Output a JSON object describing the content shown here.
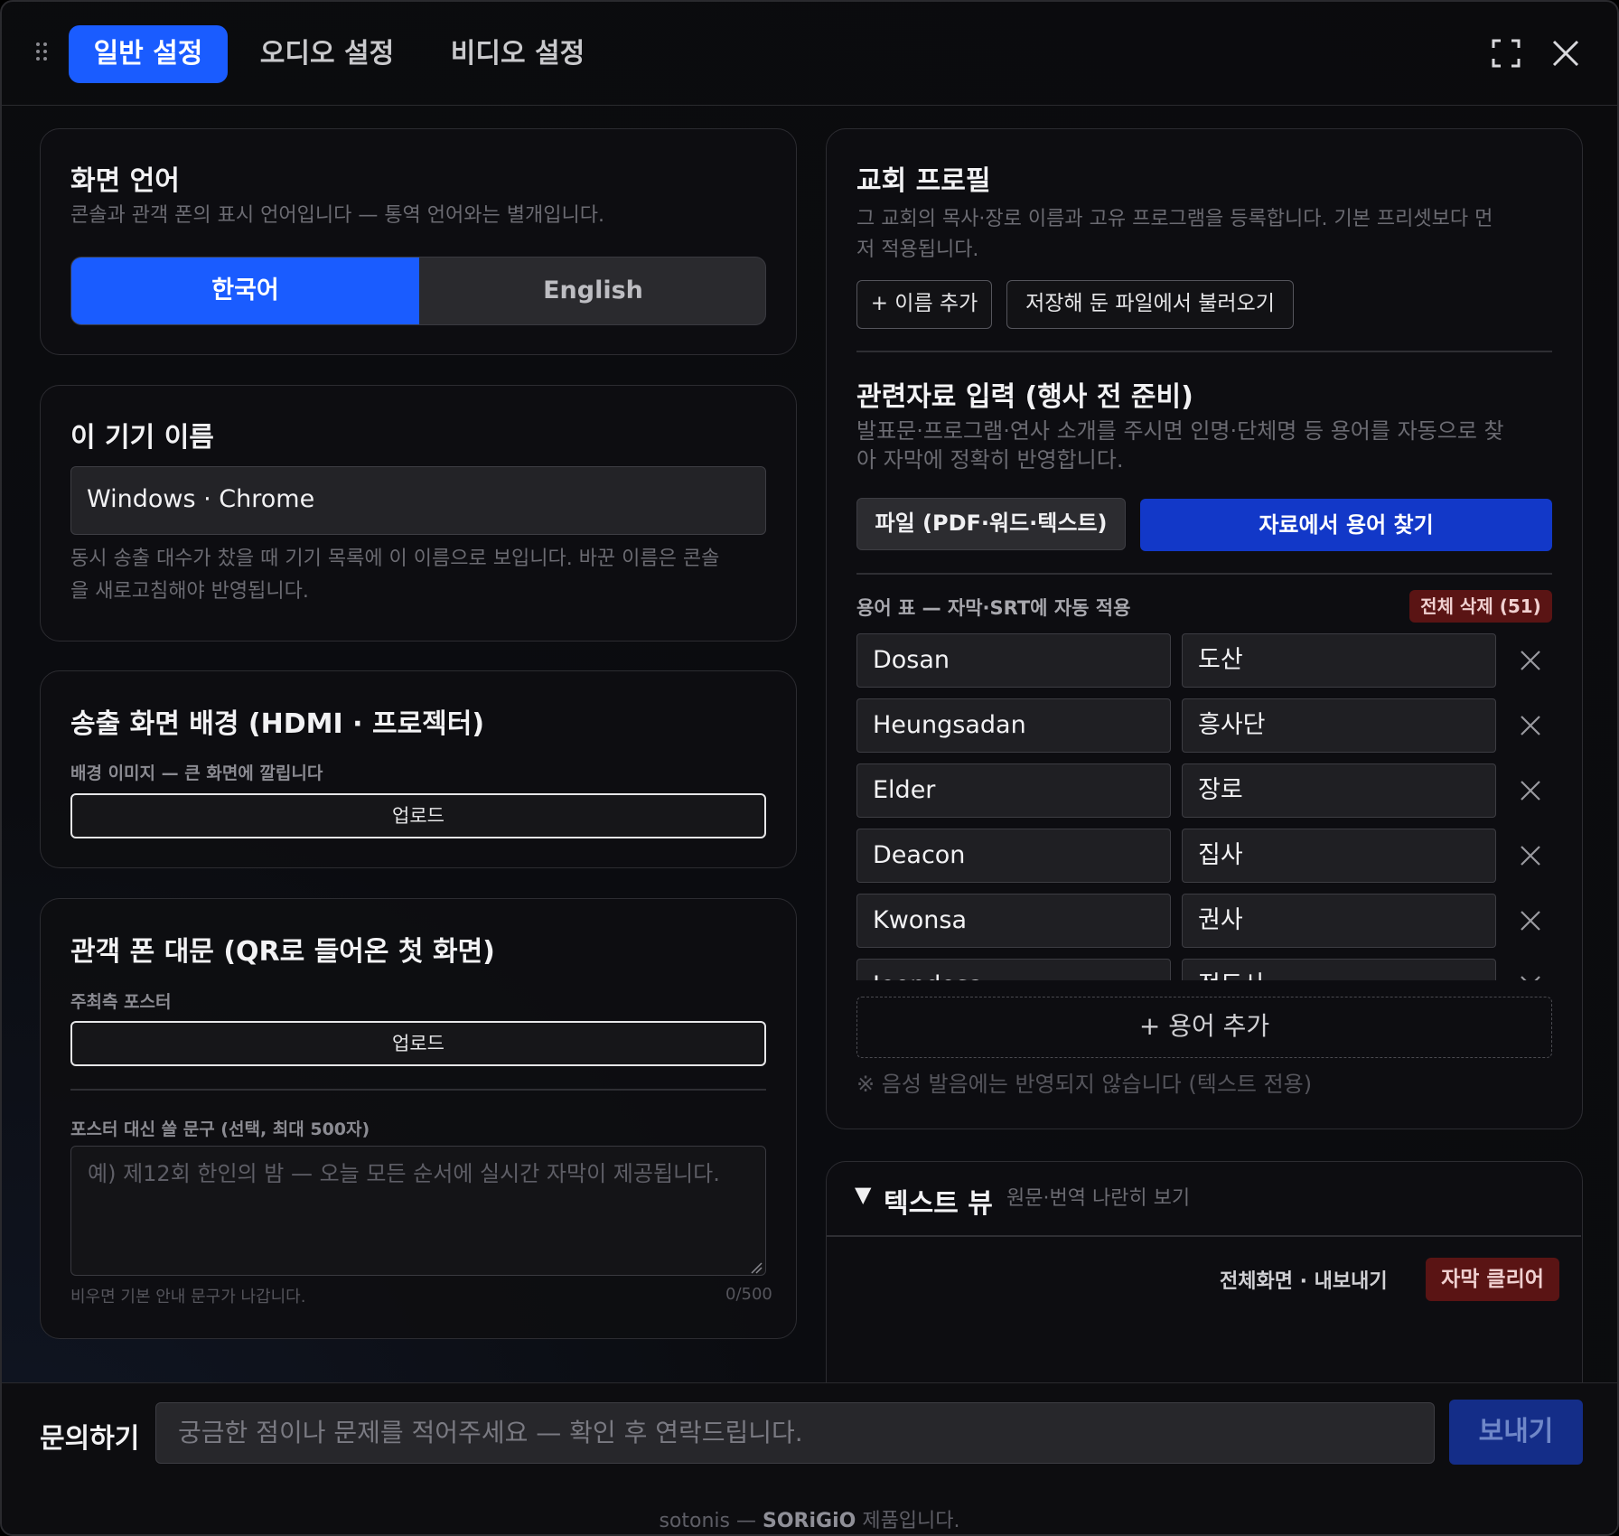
{
  "tabs": [
    {
      "label": "일반 설정",
      "active": true
    },
    {
      "label": "오디오 설정",
      "active": false
    },
    {
      "label": "비디오 설정",
      "active": false
    }
  ],
  "header_icons": [
    "drag-grip-icon",
    "fullscreen-icon",
    "close-icon"
  ],
  "accent_color": "#1a5cff",
  "display_language": {
    "title": "화면 언어",
    "description": "콘솔과 관객 폰의 표시 언어입니다 — 통역 언어와는 별개입니다.",
    "options": [
      "한국어",
      "English"
    ],
    "selected": "한국어"
  },
  "device_name": {
    "title": "이 기기 이름",
    "value": "Windows · Chrome",
    "description_line1": "동시 송출 대수가 찼을 때 기기 목록에 이 이름으로 보입니다. 바꾼 이름은 콘솔",
    "description_line2": "을 새로고침해야 반영됩니다."
  },
  "output_background": {
    "title": "송출 화면 배경 (HDMI · 프로젝터)",
    "label": "배경 이미지 — 큰 화면에 깔립니다",
    "upload_label": "업로드"
  },
  "audience_landing": {
    "title": "관객 폰 대문 (QR로 들어온 첫 화면)",
    "poster_label": "주최측 포스터",
    "upload_label": "업로드",
    "text_label": "포스터 대신 쓸 문구 (선택, 최대 500자)",
    "text_placeholder": "예) 제12회 한인의 밤 — 오늘 모든 순서에 실시간 자막이 제공됩니다.",
    "hint": "비우면 기본 안내 문구가 나갑니다.",
    "counter": "0/500"
  },
  "church_profile": {
    "title": "교회 프로필",
    "description_line1": "그 교회의 목사·장로 이름과 고유 프로그램을 등록합니다. 기본 프리셋보다 먼",
    "description_line2": "저 적용됩니다.",
    "add_name_button": "+ 이름 추가",
    "load_button": "저장해 둔 파일에서 불러오기"
  },
  "materials": {
    "title": "관련자료 입력 (행사 전 준비)",
    "description_line1": "발표문·프로그램·연사 소개를 주시면 인명·단체명 등 용어를 자동으로 찾",
    "description_line2": "아 자막에 정확히 반영합니다.",
    "file_button": "파일 (PDF·워드·텍스트)",
    "find_terms_button": "자료에서 용어 찾기"
  },
  "glossary": {
    "label": "용어 표 — 자막·SRT에 자동 적용",
    "delete_all": "전체 삭제 (51)",
    "terms": [
      {
        "source": "Dosan",
        "target": "도산"
      },
      {
        "source": "Heungsadan",
        "target": "흥사단"
      },
      {
        "source": "Elder",
        "target": "장로"
      },
      {
        "source": "Deacon",
        "target": "집사"
      },
      {
        "source": "Kwonsa",
        "target": "권사"
      },
      {
        "source": "Jeondosa",
        "target": "전도사"
      }
    ],
    "add_term": "+ 용어 추가",
    "note": "※ 음성 발음에는 반영되지 않습니다 (텍스트 전용)"
  },
  "text_view": {
    "toggle": "▼",
    "title": "텍스트 뷰",
    "subtitle": "원문·번역 나란히 보기",
    "fullscreen_export": "전체화면 · 내보내기",
    "clear_subtitles": "자막 클리어"
  },
  "contact": {
    "label": "문의하기",
    "placeholder": "궁금한 점이나 문제를 적어주세요 — 확인 후 연락드립니다.",
    "send_button": "보내기"
  },
  "footer": {
    "prefix": "sotonis —",
    "brand": "SORiGiO",
    "suffix": "제품입니다."
  }
}
